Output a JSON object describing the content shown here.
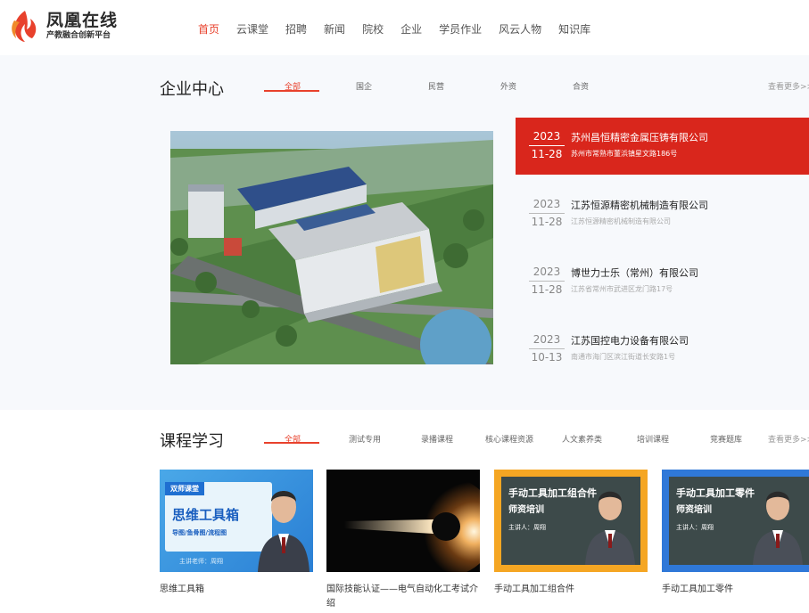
{
  "header": {
    "logo_title": "凤凰在线",
    "logo_subtitle": "产教融合创新平台",
    "nav": [
      "首页",
      "云课堂",
      "招聘",
      "新闻",
      "院校",
      "企业",
      "学员作业",
      "风云人物",
      "知识库"
    ],
    "active_nav": "首页"
  },
  "companies": {
    "title": "企业中心",
    "tabs": [
      "全部",
      "国企",
      "民营",
      "外资",
      "合资"
    ],
    "more": "查看更多>>",
    "items": [
      {
        "year": "2023",
        "day": "11-28",
        "name": "苏州昌恒精密金属压铸有限公司",
        "address": "苏州市常熟市董浜镇星文路186号"
      },
      {
        "year": "2023",
        "day": "11-28",
        "name": "江苏恒源精密机械制造有限公司",
        "address": "江苏恒源精密机械制造有限公司"
      },
      {
        "year": "2023",
        "day": "11-28",
        "name": "博世力士乐（常州）有限公司",
        "address": "江苏省常州市武进区龙门路17号"
      },
      {
        "year": "2023",
        "day": "10-13",
        "name": "江苏国控电力设备有限公司",
        "address": "南通市海门区滨江街道长安路1号"
      }
    ]
  },
  "courses": {
    "title": "课程学习",
    "tabs": [
      "全部",
      "测试专用",
      "录播课程",
      "核心课程资源",
      "人文素养类",
      "培训课程",
      "竞赛题库"
    ],
    "more": "查看更多>>",
    "items": [
      {
        "title": "思维工具箱",
        "thumb_tag": "双师课堂",
        "thumb_big": "思维工具箱",
        "thumb_sub": "导图/鱼骨图/流程图",
        "thumb_teacher": "主讲老师：周翔"
      },
      {
        "title": "国际技能认证——电气自动化工考试介绍"
      },
      {
        "title": "手动工具加工组合件",
        "thumb_big": "手动工具加工组合件",
        "thumb_sub": "师资培训",
        "thumb_teacher": "主讲人：周翔"
      },
      {
        "title": "手动工具加工零件",
        "thumb_big": "手动工具加工零件",
        "thumb_sub": "师资培训",
        "thumb_teacher": "主讲人：周翔"
      }
    ]
  },
  "colors": {
    "accent": "#e8412c",
    "active_row": "#d9261c",
    "orange_thumb": "#f5a623",
    "blue_thumb": "#2f78d8"
  }
}
